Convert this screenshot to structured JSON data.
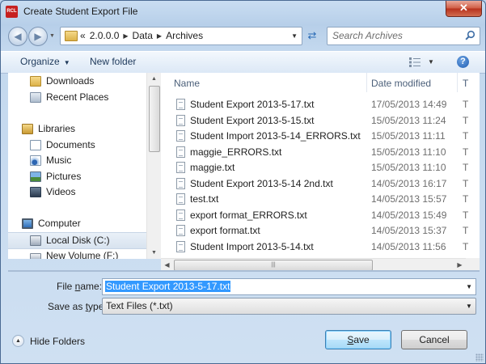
{
  "window": {
    "title": "Create Student Export File",
    "app_badge": "RCL",
    "close_label": "✕"
  },
  "address": {
    "crumbs": [
      "2.0.0.0",
      "Data",
      "Archives"
    ],
    "overflow": "«"
  },
  "search": {
    "placeholder": "Search Archives"
  },
  "toolbar": {
    "organize_label": "Organize",
    "new_folder_label": "New folder",
    "help_label": "?"
  },
  "nav": {
    "items": [
      {
        "label": "Downloads",
        "icon": "downloads-icon"
      },
      {
        "label": "Recent Places",
        "icon": "recent-places-icon"
      },
      {
        "label": "Libraries",
        "icon": "libraries-icon"
      },
      {
        "label": "Documents",
        "icon": "documents-icon"
      },
      {
        "label": "Music",
        "icon": "music-icon"
      },
      {
        "label": "Pictures",
        "icon": "pictures-icon"
      },
      {
        "label": "Videos",
        "icon": "videos-icon"
      },
      {
        "label": "Computer",
        "icon": "computer-icon"
      },
      {
        "label": "Local Disk (C:)",
        "icon": "local-disk-icon",
        "selected": true
      },
      {
        "label": "New Volume (F:)",
        "icon": "drive-icon"
      }
    ]
  },
  "files": {
    "columns": {
      "name": "Name",
      "date": "Date modified",
      "type": "T"
    },
    "rows": [
      {
        "name": "Student Export 2013-5-17.txt",
        "date": "17/05/2013 14:49",
        "type": "T"
      },
      {
        "name": "Student Export 2013-5-15.txt",
        "date": "15/05/2013 11:24",
        "type": "T"
      },
      {
        "name": "Student Import 2013-5-14_ERRORS.txt",
        "date": "15/05/2013 11:11",
        "type": "T"
      },
      {
        "name": "maggie_ERRORS.txt",
        "date": "15/05/2013 11:10",
        "type": "T"
      },
      {
        "name": "maggie.txt",
        "date": "15/05/2013 11:10",
        "type": "T"
      },
      {
        "name": "Student Export 2013-5-14 2nd.txt",
        "date": "14/05/2013 16:17",
        "type": "T"
      },
      {
        "name": "test.txt",
        "date": "14/05/2013 15:57",
        "type": "T"
      },
      {
        "name": "export format_ERRORS.txt",
        "date": "14/05/2013 15:49",
        "type": "T"
      },
      {
        "name": "export format.txt",
        "date": "14/05/2013 15:37",
        "type": "T"
      },
      {
        "name": "Student Import 2013-5-14.txt",
        "date": "14/05/2013 11:56",
        "type": "T"
      }
    ]
  },
  "form": {
    "file_name_label_prefix": "File ",
    "file_name_label_key": "n",
    "file_name_label_rest": "ame:",
    "file_name_value": "Student Export 2013-5-17.txt",
    "save_type_label_prefix": "Save as ",
    "save_type_label_key": "t",
    "save_type_label_rest": "ype:",
    "save_type_value": "Text Files (*.txt)"
  },
  "footer": {
    "hide_folders_label": "Hide Folders",
    "save_label_key": "S",
    "save_label_rest": "ave",
    "cancel_label": "Cancel"
  }
}
